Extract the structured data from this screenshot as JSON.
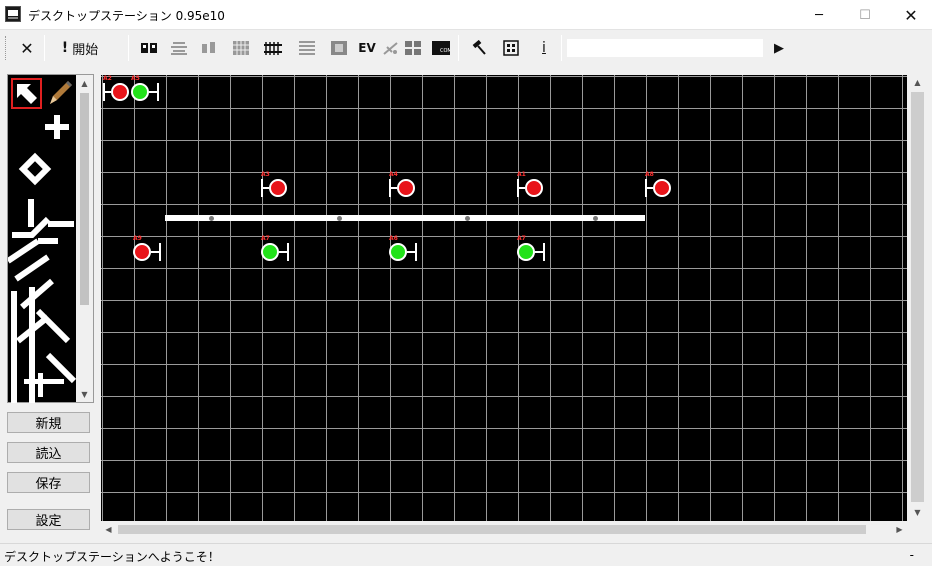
{
  "window": {
    "title": "デスクトップステーション 0.95e10",
    "minimize": "─",
    "maximize": "☐",
    "close": "✕"
  },
  "toolbar": {
    "stop_icon": "✕",
    "start_label": "開始",
    "ev_label": "EV",
    "info_glyph": "i",
    "play_icon": "▶",
    "command_value": ""
  },
  "sidebar": {
    "buttons": [
      "新規",
      "読込",
      "保存",
      "設定"
    ]
  },
  "layout": {
    "signals_top_row": [
      {
        "id": "A2",
        "state": "red"
      },
      {
        "id": "A5",
        "state": "green"
      }
    ],
    "signals_upper": [
      {
        "id": "A3",
        "state": "red"
      },
      {
        "id": "A4",
        "state": "red"
      },
      {
        "id": "A1",
        "state": "red"
      },
      {
        "id": "A8",
        "state": "red"
      }
    ],
    "signals_lower": [
      {
        "id": "A9",
        "state": "red"
      },
      {
        "id": "A7",
        "state": "green"
      },
      {
        "id": "A6",
        "state": "green"
      },
      {
        "id": "A7",
        "state": "green"
      }
    ]
  },
  "statusbar": {
    "message": "デスクトップステーションへようこそ！",
    "right": "-"
  },
  "colors": {
    "signal_red": "#e8141a",
    "signal_green": "#22e21a",
    "canvas_bg": "#000000",
    "grid": "#9a9a9a"
  }
}
